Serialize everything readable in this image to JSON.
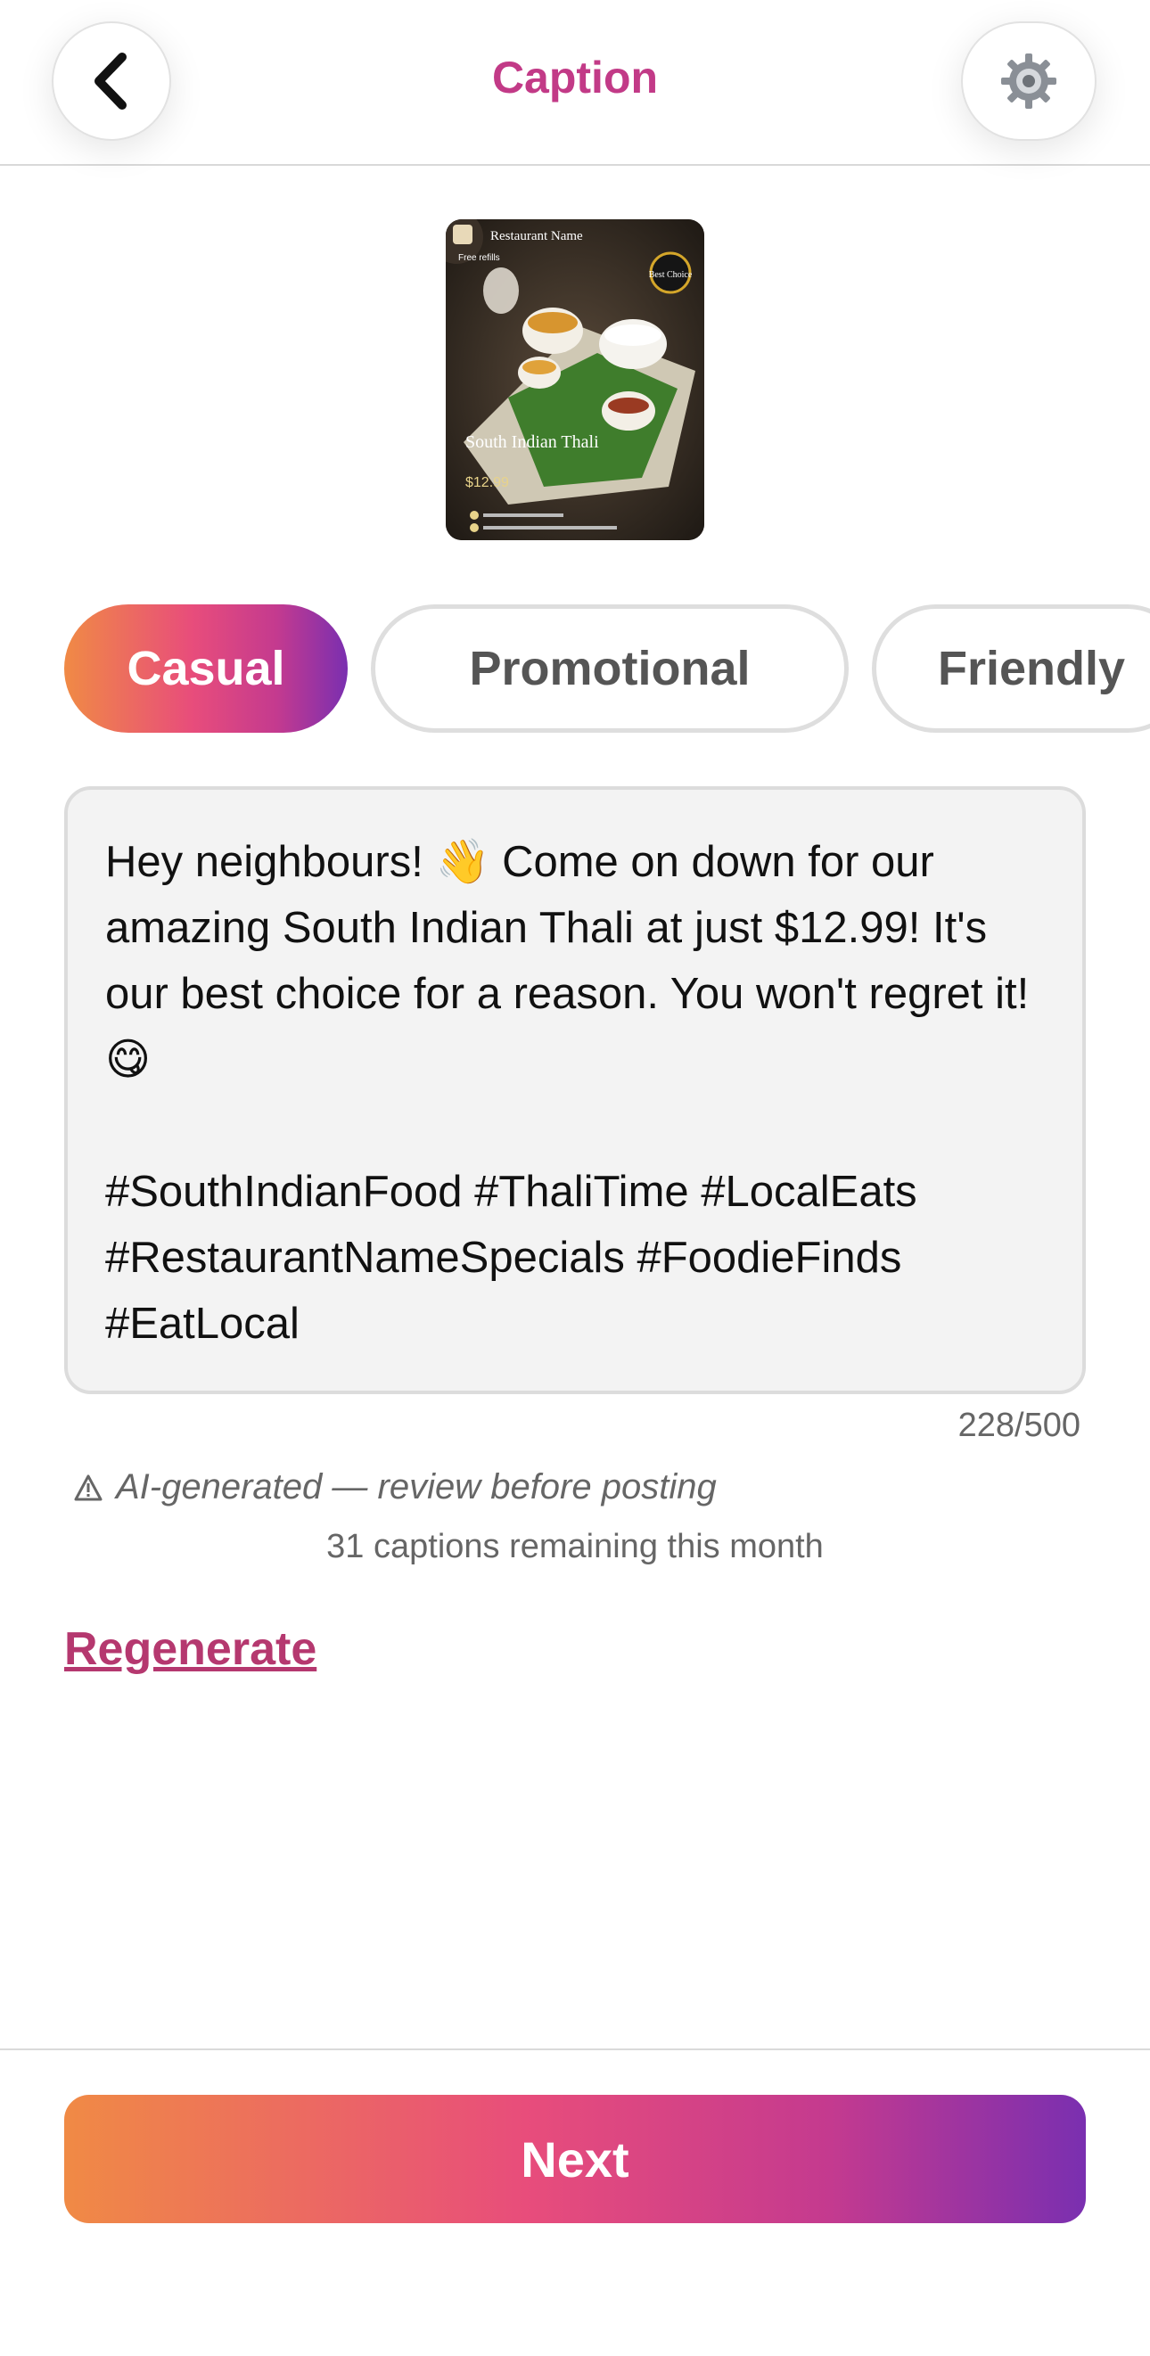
{
  "header": {
    "title": "Caption",
    "back_icon": "chevron-left-icon",
    "settings_icon": "gear-icon"
  },
  "thumbnail": {
    "restaurant_name": "Restaurant Name",
    "tagline": "Free refills",
    "badge": "Best Choice",
    "dish_name": "South Indian Thali",
    "price": "$12.99"
  },
  "tone_tabs": [
    {
      "label": "Casual",
      "selected": true
    },
    {
      "label": "Promotional",
      "selected": false
    },
    {
      "label": "Friendly",
      "selected": false
    }
  ],
  "caption": {
    "text": "Hey neighbours! 👋 Come on down for our amazing South Indian Thali at just $12.99! It's our best choice for a reason. You won't regret it! 😋\n\n#SouthIndianFood #ThaliTime #LocalEats #RestaurantNameSpecials #FoodieFinds #EatLocal",
    "counter": "228/500"
  },
  "notice": {
    "icon": "warning-icon",
    "text": "AI-generated — review before posting"
  },
  "remaining": "31 captions remaining this month",
  "regenerate_label": "Regenerate",
  "next_label": "Next",
  "colors": {
    "brand_pink": "#c23a87",
    "gradient_start": "#f08a45",
    "gradient_mid": "#e84d7b",
    "gradient_end": "#7a2fb0"
  }
}
